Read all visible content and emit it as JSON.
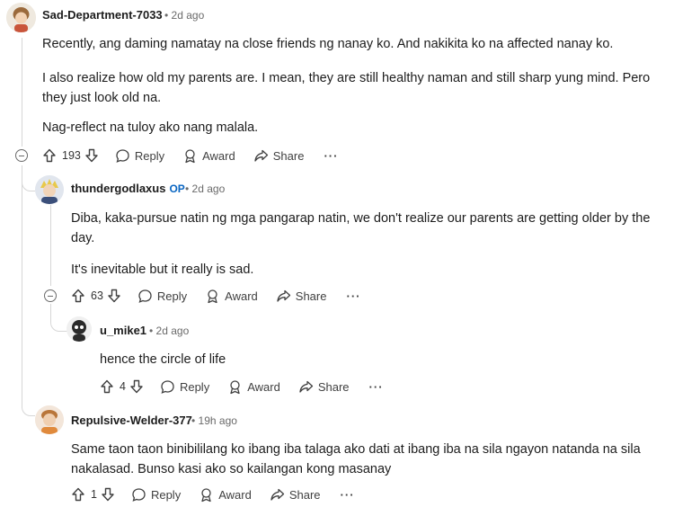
{
  "comments": [
    {
      "username": "Sad-Department-7033",
      "time": "2d ago",
      "paragraphs": [
        "Recently, ang daming namatay na close friends ng nanay ko. And nakikita ko na affected nanay ko.",
        "I also realize how old my parents are. I mean, they are still healthy naman and still sharp yung mind. Pero they just look old na.",
        "Nag-reflect na tuloy ako nang malala."
      ],
      "votes": "193"
    },
    {
      "username": "thundergodlaxus",
      "badge": "OP",
      "time": "2d ago",
      "paragraphs": [
        "Diba, kaka-pursue natin ng mga pangarap natin, we don't realize our parents are getting older by the day.",
        "It's inevitable but it really is sad."
      ],
      "votes": "63"
    },
    {
      "username": "u_mike1",
      "time": "2d ago",
      "paragraphs": [
        "hence the circle of life"
      ],
      "votes": "4"
    },
    {
      "username": "Repulsive-Welder-377",
      "time": "19h ago",
      "paragraphs": [
        "Same taon taon binibililang ko ibang iba talaga ako dati at ibang iba na sila ngayon natanda na sila nakalasad. Bunso kasi ako so kailangan kong masanay"
      ],
      "votes": "1"
    }
  ],
  "actions": {
    "reply": "Reply",
    "award": "Award",
    "share": "Share",
    "more": "···",
    "sep": "•"
  },
  "icons": [
    "upvote-icon",
    "downvote-icon",
    "reply-icon",
    "award-icon",
    "share-icon",
    "more-icon",
    "collapse-icon"
  ]
}
